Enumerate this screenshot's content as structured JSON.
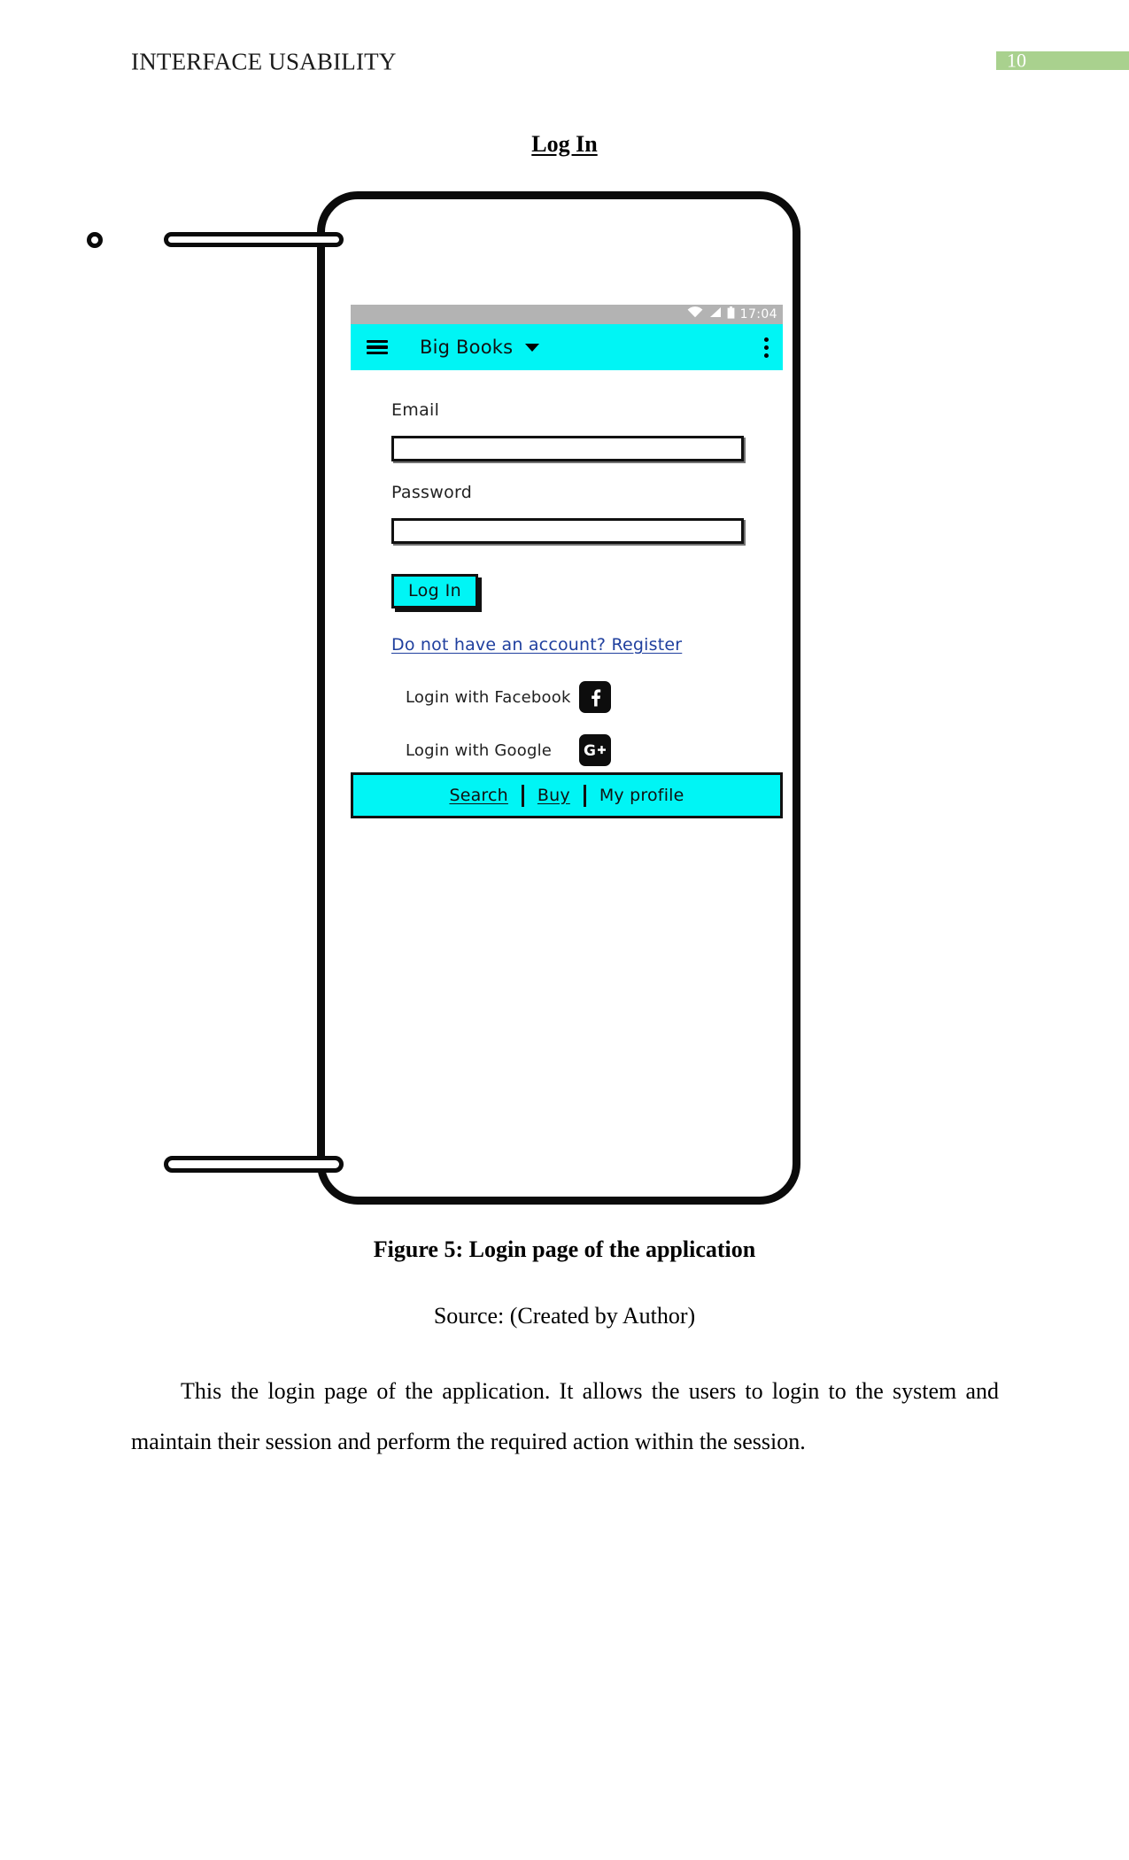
{
  "document": {
    "running_head": "INTERFACE USABILITY",
    "page_number": "10",
    "section_title": "Log In",
    "figure_caption": "Figure 5: Login page of the application",
    "figure_source": "Source: (Created by Author)",
    "body_paragraph": "This the login page of the application. It allows the users to login to the system and maintain their session and perform the required action within the session.",
    "badge_color": "#a9d18e"
  },
  "phone": {
    "status_bar": {
      "time": "17:04",
      "icons": [
        "wifi-icon",
        "signal-icon",
        "battery-icon"
      ]
    },
    "app_bar": {
      "menu_icon": "hamburger-icon",
      "title": "Big Books",
      "dropdown_icon": "chevron-down-icon",
      "overflow_icon": "kebab-menu-icon",
      "background_color": "#00f5f5"
    },
    "form": {
      "email_label": "Email",
      "email_value": "",
      "password_label": "Password",
      "password_value": "",
      "login_button": "Log In",
      "register_link": "Do not have an account? Register",
      "social": [
        {
          "label": "Login with Facebook",
          "icon": "facebook-icon"
        },
        {
          "label": "Login with Google",
          "icon": "google-plus-icon"
        }
      ]
    },
    "bottom_nav": [
      {
        "label": "Search",
        "underlined": true
      },
      {
        "label": "Buy",
        "underlined": true
      },
      {
        "label": "My profile",
        "underlined": false
      }
    ]
  }
}
